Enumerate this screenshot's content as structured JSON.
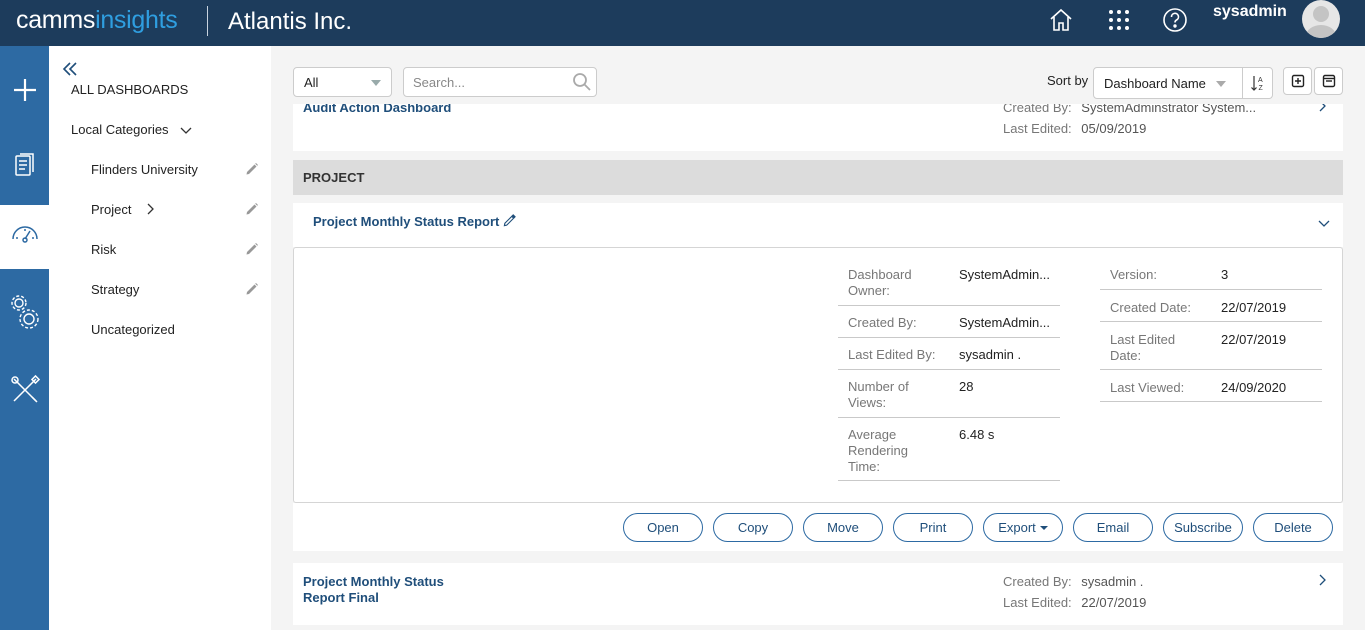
{
  "brand": {
    "part1": "camms",
    "part2": "insights",
    "org": "Atlantis Inc."
  },
  "header": {
    "icons": [
      "home-icon",
      "apps-grid-icon",
      "help-icon"
    ],
    "username": "sysadmin"
  },
  "rail": {
    "items": [
      "add-icon",
      "reports-icon",
      "dashboard-icon",
      "settings-icon",
      "tools-icon"
    ],
    "active": "dashboard-icon"
  },
  "sidebar": {
    "all_dashboards": "ALL DASHBOARDS",
    "local_categories": "Local Categories",
    "categories": [
      {
        "label": "Flinders University",
        "editable": true
      },
      {
        "label": "Project",
        "editable": true,
        "has_children": true
      },
      {
        "label": "Risk",
        "editable": true
      },
      {
        "label": "Strategy",
        "editable": true
      },
      {
        "label": "Uncategorized",
        "editable": false
      }
    ]
  },
  "toolbar": {
    "filter_value": "All",
    "search_placeholder": "Search...",
    "sort_label": "Sort by",
    "sort_value": "Dashboard Name"
  },
  "audit_card": {
    "title": "Audit Action Dashboard",
    "created_by_label": "Created By:",
    "created_by": "SystemAdminstrator System...",
    "last_edited_label": "Last Edited:",
    "last_edited": "05/09/2019"
  },
  "section": {
    "title": "PROJECT"
  },
  "expanded_card": {
    "title": "Project Monthly Status Report",
    "left_rows": [
      {
        "label": "Dashboard Owner:",
        "value": "SystemAdmin..."
      },
      {
        "label": "Created By:",
        "value": "SystemAdmin..."
      },
      {
        "label": "Last Edited By:",
        "value": "sysadmin ."
      },
      {
        "label": "Number of Views:",
        "value": "28"
      },
      {
        "label": "Average Rendering Time:",
        "value": "6.48 s"
      }
    ],
    "right_rows": [
      {
        "label": "Version:",
        "value": "3"
      },
      {
        "label": "Created Date:",
        "value": "22/07/2019"
      },
      {
        "label": "Last Edited Date:",
        "value": "22/07/2019"
      },
      {
        "label": "Last Viewed:",
        "value": "24/09/2020"
      }
    ],
    "actions": [
      "Open",
      "Copy",
      "Move",
      "Print",
      "Export",
      "Email",
      "Subscribe",
      "Delete"
    ]
  },
  "final_card": {
    "title_line1": "Project Monthly Status",
    "title_line2": "Report Final",
    "created_by_label": "Created By:",
    "created_by": "sysadmin .",
    "last_edited_label": "Last Edited:",
    "last_edited": "22/07/2019"
  },
  "colors": {
    "topbar": "#1d3c5c",
    "rail": "#2d6aa3",
    "accent": "#2f9ee0",
    "link": "#1f4e7a"
  }
}
